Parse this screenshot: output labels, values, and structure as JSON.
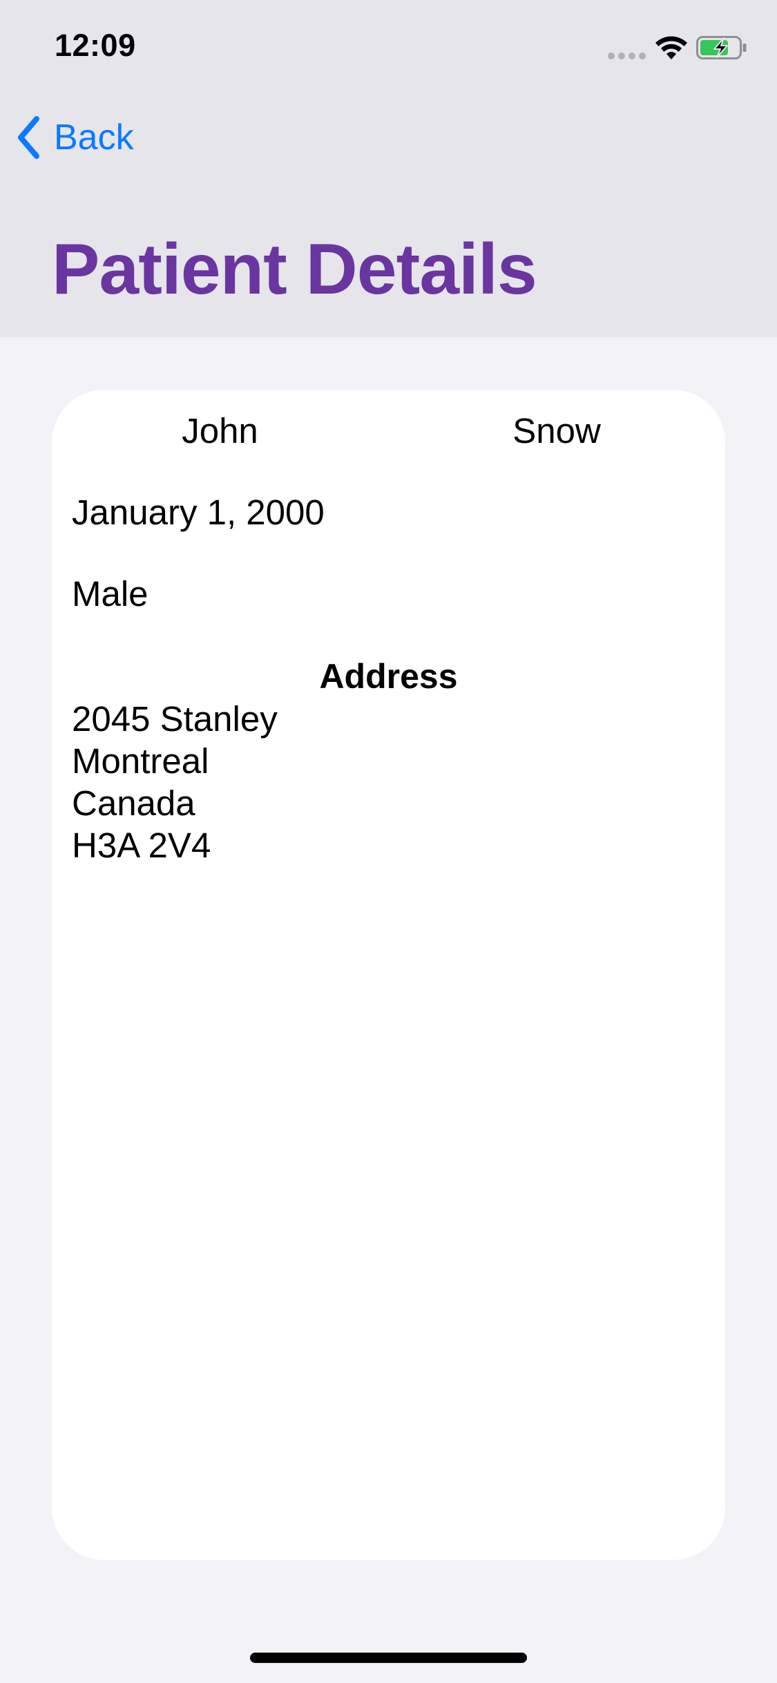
{
  "status_bar": {
    "time": "12:09",
    "signal_icon": "signal-dots-icon",
    "wifi_icon": "wifi-icon",
    "battery_icon": "battery-charging-icon",
    "battery_color": "#34C759"
  },
  "nav": {
    "back_label": "Back",
    "back_icon": "chevron-left-icon",
    "accent_color": "#0A7AFF"
  },
  "header": {
    "title": "Patient Details",
    "title_color": "#6A35A0"
  },
  "patient": {
    "first_name": "John",
    "last_name": "Snow",
    "date_of_birth": "January 1, 2000",
    "gender": "Male",
    "address_heading": "Address",
    "address": {
      "street": "2045 Stanley",
      "city": "Montreal",
      "country": "Canada",
      "postal_code": "H3A 2V4"
    }
  }
}
